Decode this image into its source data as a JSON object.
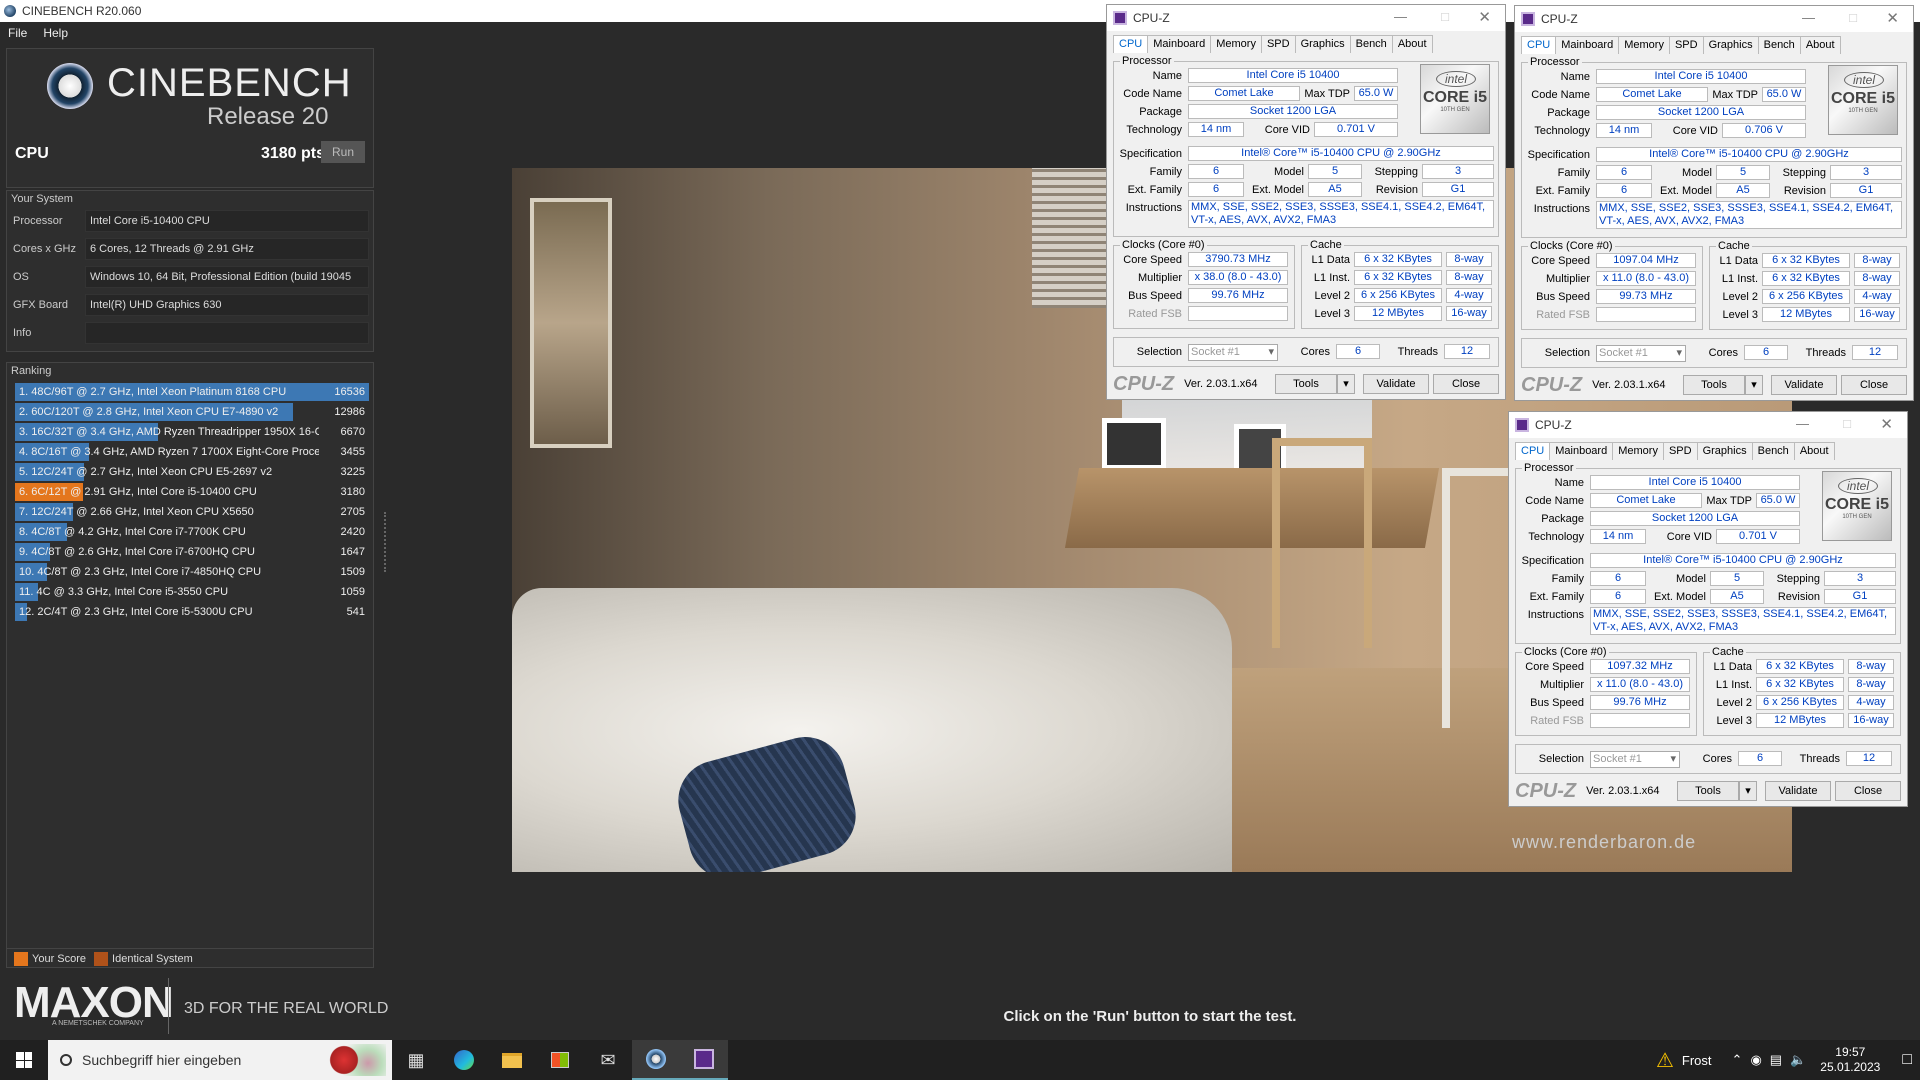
{
  "window": {
    "title": "CINEBENCH R20.060"
  },
  "menu": [
    "File",
    "Help"
  ],
  "logo": {
    "name": "CINEBENCH",
    "release": "Release 20"
  },
  "test": {
    "label": "CPU",
    "score": "3180 pts",
    "run_label": "Run"
  },
  "your_system": {
    "title": "Your System",
    "rows": [
      {
        "label": "Processor",
        "value": "Intel Core i5-10400 CPU"
      },
      {
        "label": "Cores x GHz",
        "value": "6 Cores, 12 Threads @ 2.91 GHz"
      },
      {
        "label": "OS",
        "value": "Windows 10, 64 Bit, Professional Edition (build 19045"
      },
      {
        "label": "GFX Board",
        "value": "Intel(R) UHD Graphics 630"
      },
      {
        "label": "Info",
        "value": ""
      }
    ]
  },
  "ranking": {
    "title": "Ranking",
    "rows": [
      {
        "text": "1. 48C/96T @ 2.7 GHz, Intel Xeon Platinum 8168 CPU",
        "score": "16536",
        "value": 16536,
        "mine": false
      },
      {
        "text": "2. 60C/120T @ 2.8 GHz, Intel Xeon CPU E7-4890 v2",
        "score": "12986",
        "value": 12986,
        "mine": false
      },
      {
        "text": "3. 16C/32T @ 3.4 GHz, AMD Ryzen Threadripper 1950X 16-C",
        "score": "6670",
        "value": 6670,
        "mine": false
      },
      {
        "text": "4. 8C/16T @ 3.4 GHz, AMD Ryzen 7 1700X Eight-Core Proce:",
        "score": "3455",
        "value": 3455,
        "mine": false
      },
      {
        "text": "5. 12C/24T @ 2.7 GHz, Intel Xeon CPU E5-2697 v2",
        "score": "3225",
        "value": 3225,
        "mine": false
      },
      {
        "text": "6. 6C/12T @ 2.91 GHz, Intel Core i5-10400 CPU",
        "score": "3180",
        "value": 3180,
        "mine": true
      },
      {
        "text": "7. 12C/24T @ 2.66 GHz, Intel Xeon CPU X5650",
        "score": "2705",
        "value": 2705,
        "mine": false
      },
      {
        "text": "8. 4C/8T @ 4.2 GHz, Intel Core i7-7700K CPU",
        "score": "2420",
        "value": 2420,
        "mine": false
      },
      {
        "text": "9. 4C/8T @ 2.6 GHz, Intel Core i7-6700HQ CPU",
        "score": "1647",
        "value": 1647,
        "mine": false
      },
      {
        "text": "10. 4C/8T @ 2.3 GHz, Intel Core i7-4850HQ CPU",
        "score": "1509",
        "value": 1509,
        "mine": false
      },
      {
        "text": "11. 4C @ 3.3 GHz, Intel Core i5-3550 CPU",
        "score": "1059",
        "value": 1059,
        "mine": false
      },
      {
        "text": "12. 2C/4T @ 2.3 GHz, Intel Core i5-5300U CPU",
        "score": "541",
        "value": 541,
        "mine": false
      }
    ],
    "max_value": 16536
  },
  "legend": {
    "your_score": "Your Score",
    "identical": "Identical System"
  },
  "maxon": {
    "name": "MAXON",
    "sub": "A NEMETSCHEK COMPANY",
    "tagline": "3D FOR THE REAL WORLD"
  },
  "hint": "Click on the 'Run' button to start the test.",
  "render": {
    "watermark": "www.renderbaron.de"
  },
  "colors": {
    "rank_bar": "#3d78b4",
    "your_score": "#e4761d",
    "identical": "#b0521a"
  },
  "cpuz": {
    "title": "CPU-Z",
    "tabs": [
      "CPU",
      "Mainboard",
      "Memory",
      "SPD",
      "Graphics",
      "Bench",
      "About"
    ],
    "labels": {
      "processor": "Processor",
      "name": "Name",
      "code_name": "Code Name",
      "max_tdp": "Max TDP",
      "package": "Package",
      "technology": "Technology",
      "core_vid": "Core VID",
      "specification": "Specification",
      "family": "Family",
      "model": "Model",
      "stepping": "Stepping",
      "ext_family": "Ext. Family",
      "ext_model": "Ext. Model",
      "revision": "Revision",
      "instructions": "Instructions",
      "clocks": "Clocks (Core #0)",
      "core_speed": "Core Speed",
      "multiplier": "Multiplier",
      "bus_speed": "Bus Speed",
      "rated_fsb": "Rated FSB",
      "cache": "Cache",
      "l1_data": "L1 Data",
      "l1_inst": "L1 Inst.",
      "level2": "Level 2",
      "level3": "Level 3",
      "selection": "Selection",
      "cores": "Cores",
      "threads": "Threads"
    },
    "intel_badge": {
      "brand": "intel",
      "line": "CORE i5",
      "gen": "10TH GEN"
    },
    "version": "Ver. 2.03.1.x64",
    "buttons": {
      "tools": "Tools",
      "validate": "Validate",
      "close": "Close"
    },
    "windows": [
      {
        "name": "Intel Core i5 10400",
        "code_name": "Comet Lake",
        "max_tdp": "65.0 W",
        "package": "Socket 1200 LGA",
        "technology": "14 nm",
        "core_vid": "0.701 V",
        "specification": "Intel® Core™ i5-10400 CPU @ 2.90GHz",
        "family": "6",
        "model": "5",
        "stepping": "3",
        "ext_family": "6",
        "ext_model": "A5",
        "revision": "G1",
        "instructions": "MMX, SSE, SSE2, SSE3, SSSE3, SSE4.1, SSE4.2, EM64T, VT-x, AES, AVX, AVX2, FMA3",
        "core_speed": "3790.73 MHz",
        "multiplier": "x 38.0 (8.0 - 43.0)",
        "bus_speed": "99.76 MHz",
        "rated_fsb": "",
        "l1_data": "6 x 32 KBytes",
        "l1_data_way": "8-way",
        "l1_inst": "6 x 32 KBytes",
        "l1_inst_way": "8-way",
        "level2": "6 x 256 KBytes",
        "level2_way": "4-way",
        "level3": "12 MBytes",
        "level3_way": "16-way",
        "selection": "Socket #1",
        "cores": "6",
        "threads": "12"
      },
      {
        "name": "Intel Core i5 10400",
        "code_name": "Comet Lake",
        "max_tdp": "65.0 W",
        "package": "Socket 1200 LGA",
        "technology": "14 nm",
        "core_vid": "0.706 V",
        "specification": "Intel® Core™ i5-10400 CPU @ 2.90GHz",
        "family": "6",
        "model": "5",
        "stepping": "3",
        "ext_family": "6",
        "ext_model": "A5",
        "revision": "G1",
        "instructions": "MMX, SSE, SSE2, SSE3, SSSE3, SSE4.1, SSE4.2, EM64T, VT-x, AES, AVX, AVX2, FMA3",
        "core_speed": "1097.04 MHz",
        "multiplier": "x 11.0 (8.0 - 43.0)",
        "bus_speed": "99.73 MHz",
        "rated_fsb": "",
        "l1_data": "6 x 32 KBytes",
        "l1_data_way": "8-way",
        "l1_inst": "6 x 32 KBytes",
        "l1_inst_way": "8-way",
        "level2": "6 x 256 KBytes",
        "level2_way": "4-way",
        "level3": "12 MBytes",
        "level3_way": "16-way",
        "selection": "Socket #1",
        "cores": "6",
        "threads": "12"
      },
      {
        "name": "Intel Core i5 10400",
        "code_name": "Comet Lake",
        "max_tdp": "65.0 W",
        "package": "Socket 1200 LGA",
        "technology": "14 nm",
        "core_vid": "0.701 V",
        "specification": "Intel® Core™ i5-10400 CPU @ 2.90GHz",
        "family": "6",
        "model": "5",
        "stepping": "3",
        "ext_family": "6",
        "ext_model": "A5",
        "revision": "G1",
        "instructions": "MMX, SSE, SSE2, SSE3, SSSE3, SSE4.1, SSE4.2, EM64T, VT-x, AES, AVX, AVX2, FMA3",
        "core_speed": "1097.32 MHz",
        "multiplier": "x 11.0 (8.0 - 43.0)",
        "bus_speed": "99.76 MHz",
        "rated_fsb": "",
        "l1_data": "6 x 32 KBytes",
        "l1_data_way": "8-way",
        "l1_inst": "6 x 32 KBytes",
        "l1_inst_way": "8-way",
        "level2": "6 x 256 KBytes",
        "level2_way": "4-way",
        "level3": "12 MBytes",
        "level3_way": "16-way",
        "selection": "Socket #1",
        "cores": "6",
        "threads": "12"
      }
    ]
  },
  "taskbar": {
    "search_placeholder": "Suchbegriff hier eingeben",
    "weather": "Frost",
    "time": "19:57",
    "date": "25.01.2023",
    "icons": [
      "task-view-icon",
      "edge-icon",
      "file-explorer-icon",
      "store-icon",
      "mail-icon",
      "cinebench-icon",
      "cpuz-icon"
    ]
  }
}
